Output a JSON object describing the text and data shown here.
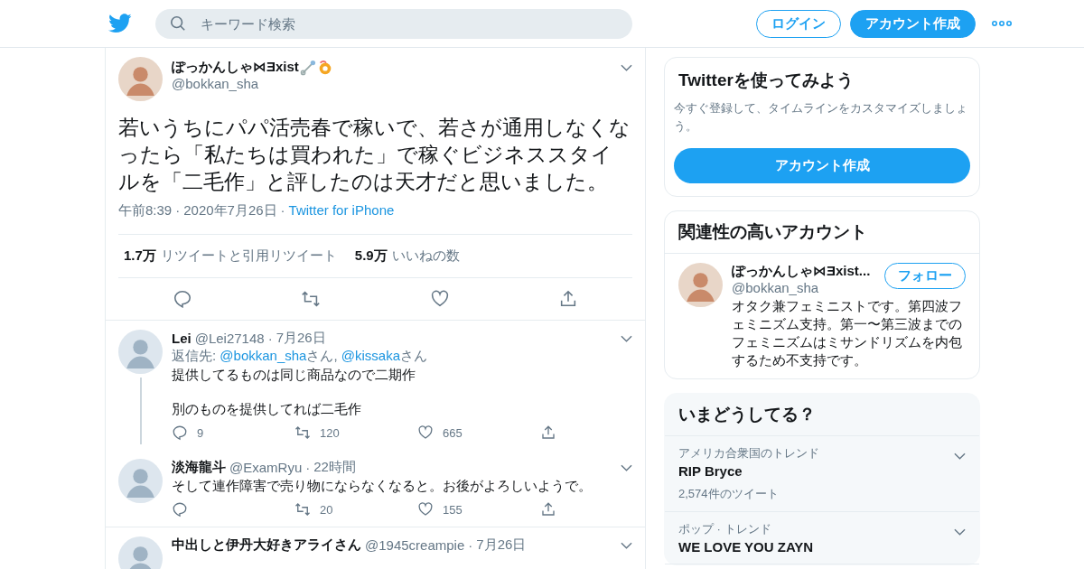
{
  "header": {
    "search": {
      "placeholder": "キーワード検索"
    },
    "login": "ログイン",
    "signup": "アカウント作成"
  },
  "tweet": {
    "name": "ぽっかんしゃ⋈Ǝxist",
    "handle": "@bokkan_sha",
    "separator": "·",
    "text": "若いうちにパパ活売春で稼いで、若さが通用しなくなったら「私たちは買われた」で稼ぐビジネススタイルを「二毛作」と評したのは天才だと思いました。",
    "time": "午前8:39",
    "date": "2020年7月26日",
    "source": "Twitter for iPhone",
    "stats": [
      {
        "count": "1.7万",
        "label": "リツイートと引用リツイート"
      },
      {
        "count": "5.9万",
        "label": "いいねの数"
      }
    ]
  },
  "replies": [
    {
      "name": "Lei",
      "handle": "@Lei27148",
      "time": "7月26日",
      "separator": "·",
      "reply_to": {
        "prefix": "返信先: ",
        "joiner": ", ",
        "mentions": [
          {
            "handle": "@bokkan_sha",
            "suffix": "さん"
          },
          {
            "handle": "@kissaka",
            "suffix": "さん"
          }
        ]
      },
      "paragraphs": [
        "提供してるものは同じ商品なので二期作",
        "別のものを提供してれば二毛作"
      ],
      "thread": true,
      "replies_count": "9",
      "retweets": "120",
      "likes": "665"
    },
    {
      "name": "淡海龍斗",
      "handle": "@ExamRyu",
      "time": "22時間",
      "separator": "·",
      "paragraphs": [
        "そして連作障害で売り物にならなくなると。お後がよろしいようで。"
      ],
      "thread": false,
      "retweets": "20",
      "likes": "155"
    },
    {
      "name": "中出しと伊丹大好きアライさん",
      "handle": "@1945creampie",
      "time": "7月26日",
      "separator": "·",
      "thread": false
    }
  ],
  "sidebar": {
    "signup_card": {
      "title": "Twitterを使ってみよう",
      "text": "今すぐ登録して、タイムラインをカスタマイズしましょう。",
      "button": "アカウント作成"
    },
    "related": {
      "title": "関連性の高いアカウント",
      "accounts": [
        {
          "name": "ぽっかんしゃ⋈Ǝxist...",
          "handle": "@bokkan_sha",
          "follow": "フォロー",
          "bio": "オタク兼フェミニストです。第四波フェミニズム支持。第一〜第三波までのフェミニズムはミサンドリズムを内包するため不支持です。"
        }
      ]
    },
    "trends": {
      "title": "いまどうしてる？",
      "items": [
        {
          "context": "アメリカ合衆国のトレンド",
          "name": "RIP Bryce",
          "count": "2,574件のツイート"
        },
        {
          "context": "ポップ · トレンド",
          "name": "WE LOVE YOU ZAYN"
        }
      ]
    }
  }
}
